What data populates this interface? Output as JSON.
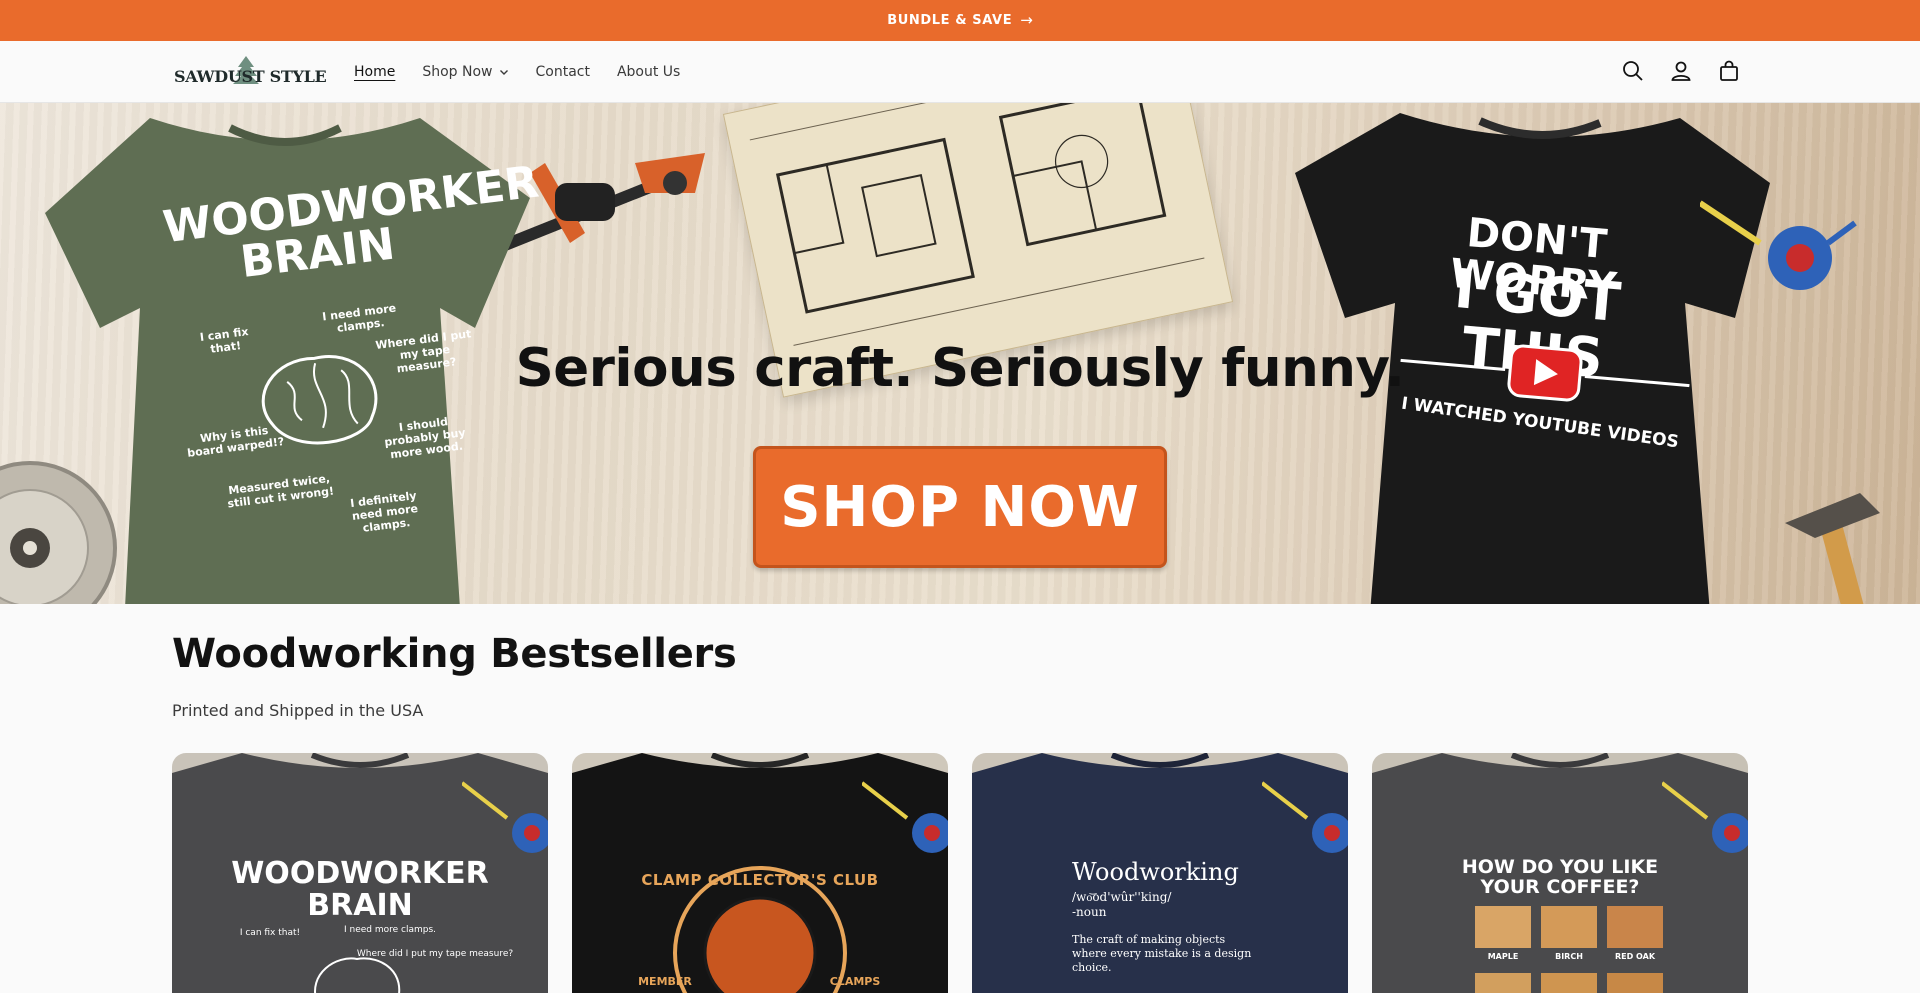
{
  "announcement": {
    "text": "BUNDLE & SAVE",
    "arrow_icon": "arrow-right-icon"
  },
  "header": {
    "logo_text": "SAWDUST STYLE",
    "nav": [
      {
        "label": "Home",
        "active": true
      },
      {
        "label": "Shop Now",
        "has_dropdown": true
      },
      {
        "label": "Contact"
      },
      {
        "label": "About Us"
      }
    ],
    "icons": [
      "search-icon",
      "account-icon",
      "cart-icon"
    ]
  },
  "hero": {
    "headline": "Serious craft. Seriously funny.",
    "cta_label": "SHOP NOW",
    "left_shirt": {
      "title_line1": "WOODWORKER",
      "title_line2": "BRAIN",
      "bubbles": [
        "I can fix that!",
        "I need more clamps.",
        "Where did I put my tape measure?",
        "Why is this board warped!?",
        "I should probably buy more wood.",
        "Measured twice, still cut it wrong!",
        "I definitely need more clamps."
      ]
    },
    "right_shirt": {
      "line1": "DON'T WORRY",
      "line2": "I GOT THIS",
      "line3": "I WATCHED YOUTUBE VIDEOS"
    }
  },
  "section": {
    "title": "Woodworking Bestsellers",
    "subtitle": "Printed and Shipped in the USA"
  },
  "products": [
    {
      "color": "#4a4a4c",
      "art_type": "brain",
      "line1": "WOODWORKER",
      "line2": "BRAIN",
      "line3": "I can fix that!",
      "line4": "I need more clamps.",
      "line5": "Where did I put my tape measure?"
    },
    {
      "color": "#141414",
      "art_type": "badge",
      "line1": "CLAMP COLLECTOR'S CLUB",
      "line2": "MEMBER",
      "line3": "CLAMPS"
    },
    {
      "color": "#27304a",
      "art_type": "definition",
      "line1": "Woodworking",
      "line2": "/wo͝od'wûr''king/",
      "line3": "-noun",
      "line4": "The craft of making objects where every mistake is a design choice."
    },
    {
      "color": "#4a4a4c",
      "art_type": "coffee",
      "line1": "HOW DO YOU LIKE",
      "line2": "YOUR COFFEE?",
      "swatches": [
        "MAPLE",
        "BIRCH",
        "RED OAK"
      ]
    }
  ]
}
